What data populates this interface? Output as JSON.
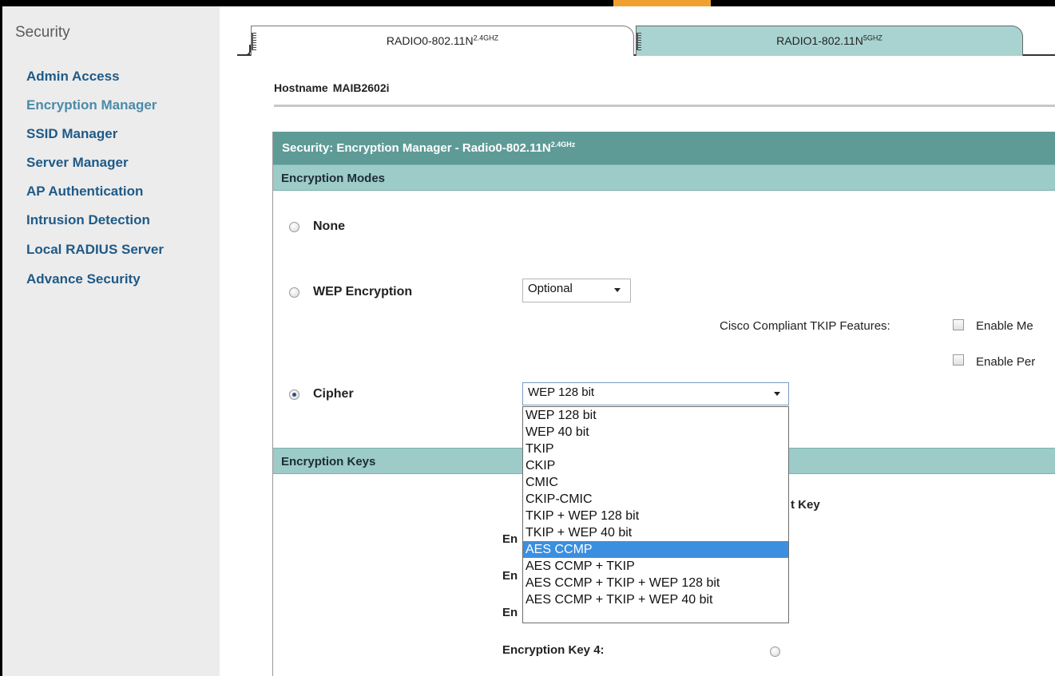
{
  "sidebar": {
    "title": "Security",
    "items": [
      {
        "label": "Admin Access"
      },
      {
        "label": "Encryption Manager"
      },
      {
        "label": "SSID Manager"
      },
      {
        "label": "Server Manager"
      },
      {
        "label": "AP Authentication"
      },
      {
        "label": "Intrusion Detection"
      },
      {
        "label": "Local RADIUS Server"
      },
      {
        "label": "Advance Security"
      }
    ]
  },
  "tabs": [
    {
      "label": "RADIO0-802.11N",
      "sup": "2.4GHZ"
    },
    {
      "label": "RADIO1-802.11N",
      "sup": "5GHZ"
    }
  ],
  "hostname": {
    "label": "Hostname",
    "value": "MAIB2602i"
  },
  "panel": {
    "title": "Security: Encryption Manager - Radio0-802.11N",
    "title_sup": "2.4GHz"
  },
  "encryption_modes": {
    "heading": "Encryption Modes",
    "none_label": "None",
    "wep_label": "WEP Encryption",
    "wep_value": "Optional",
    "tkip_features_label": "Cisco Compliant TKIP Features:",
    "tkip_checkbox_1": "Enable Me",
    "tkip_checkbox_2": "Enable Per",
    "cipher_label": "Cipher",
    "cipher_value": "WEP 128 bit",
    "cipher_options": [
      "WEP 128 bit",
      "WEP 40 bit",
      "TKIP",
      "CKIP",
      "CMIC",
      "CKIP-CMIC",
      "TKIP + WEP 128 bit",
      "TKIP + WEP 40 bit",
      "AES CCMP",
      "AES CCMP + TKIP",
      "AES CCMP + TKIP + WEP 128 bit",
      "AES CCMP + TKIP + WEP 40 bit"
    ],
    "highlighted_option": "AES CCMP"
  },
  "encryption_keys": {
    "heading": "Encryption Keys",
    "transmit_partial": "t Key",
    "row_prefix": "En",
    "key4_label": "Encryption Key 4:"
  },
  "colors": {
    "header_bg": "#5e9b97",
    "section_bg": "#9ccbc8",
    "link": "#1f5a87",
    "highlight": "#3b8fe0"
  }
}
